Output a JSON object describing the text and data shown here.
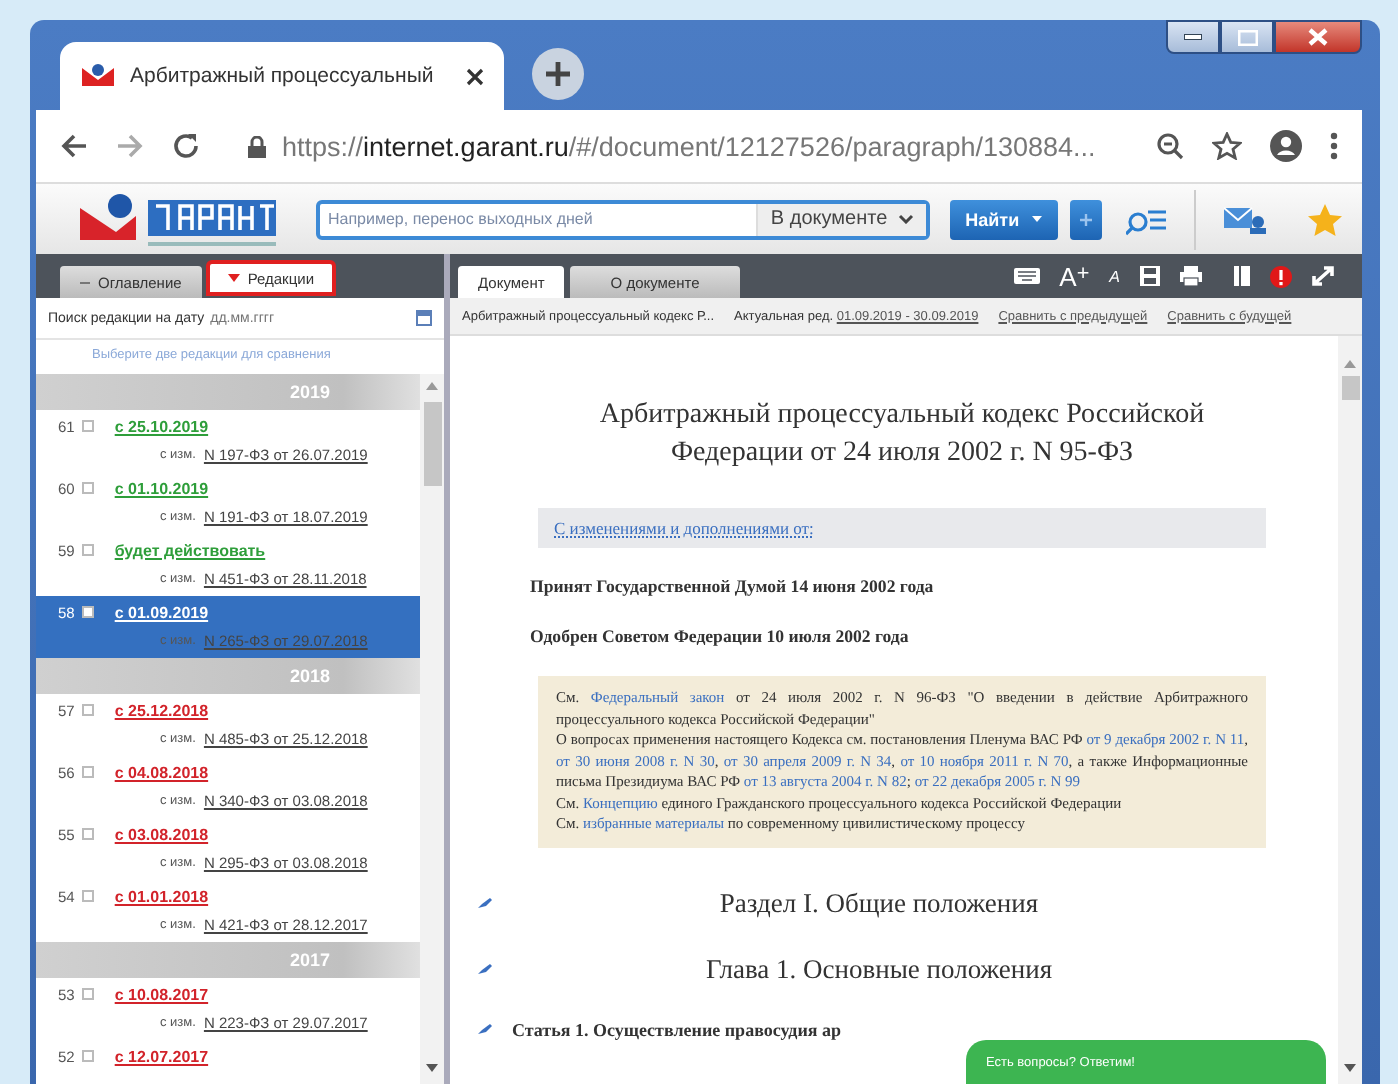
{
  "browser": {
    "tab_title": "Арбитражный процессуальный",
    "url": "https://**internet.garant.ru**/#/document/12127526/paragraph/130884..."
  },
  "toolbar": {
    "search_placeholder": "Например, перенос выходных дней",
    "scope": "В документе",
    "search_button": "Найти"
  },
  "left_tabs": [
    {
      "label": "Оглавление",
      "selected": false
    },
    {
      "label": "Редакции",
      "selected": true
    }
  ],
  "date_search": {
    "label": "Поиск редакции на дату",
    "placeholder": "дд.мм.гггг"
  },
  "hint": "Выберите две редакции для сравнения",
  "editions": [
    {
      "year": "2019",
      "items": [
        {
          "number": "61",
          "checked": false,
          "selected": false,
          "date": "с 25.10.2019",
          "color": "#2e9e3a",
          "change_label": "с изм.",
          "change": "N 197-ФЗ от 26.07.2019"
        },
        {
          "number": "60",
          "checked": false,
          "selected": false,
          "date": "с 01.10.2019",
          "color": "#2e9e3a",
          "change_label": "с изм.",
          "change": "N 191-ФЗ от 18.07.2019"
        },
        {
          "number": "59",
          "checked": false,
          "selected": false,
          "date": "будет действовать",
          "color": "#2e9e3a",
          "change_label": "с изм.",
          "change": "N 451-ФЗ от 28.11.2018"
        },
        {
          "number": "58",
          "checked": false,
          "selected": true,
          "date": "с 01.09.2019",
          "change_label": "с изм.",
          "change": "N 265-ФЗ от 29.07.2018"
        }
      ]
    },
    {
      "year": "2018",
      "items": [
        {
          "number": "57",
          "checked": false,
          "selected": false,
          "date": "с 25.12.2018",
          "color": "#d2232a",
          "change_label": "с изм.",
          "change": "N 485-ФЗ от 25.12.2018"
        },
        {
          "number": "56",
          "checked": false,
          "selected": false,
          "date": "с 04.08.2018",
          "color": "#d2232a",
          "change_label": "с изм.",
          "change": "N 340-ФЗ от 03.08.2018"
        },
        {
          "number": "55",
          "checked": false,
          "selected": false,
          "date": "с 03.08.2018",
          "color": "#d2232a",
          "change_label": "с изм.",
          "change": "N 295-ФЗ от 03.08.2018"
        },
        {
          "number": "54",
          "checked": false,
          "selected": false,
          "date": "с 01.01.2018",
          "color": "#d2232a",
          "change_label": "с изм.",
          "change": "N 421-ФЗ от 28.12.2017"
        }
      ]
    },
    {
      "year": "2017",
      "items": [
        {
          "number": "53",
          "checked": false,
          "selected": false,
          "date": "с 10.08.2017",
          "color": "#d2232a",
          "change_label": "с изм.",
          "change": "N 223-ФЗ от 29.07.2017"
        },
        {
          "number": "52",
          "checked": false,
          "selected": false,
          "date": "с 12.07.2017",
          "color": "#d2232a"
        }
      ]
    }
  ],
  "doc_tabs": [
    {
      "label": "Документ",
      "selected": true
    },
    {
      "label": "О документе",
      "selected": false
    }
  ],
  "doc_toolbar": {
    "font_increase": "A$^{+}$",
    "font_decrease": "A"
  },
  "info_bar": {
    "doc_name": "Арбитражный процессуальный кодекс Р...",
    "edition_label": "Актуальная ред.",
    "edition_dates": "01.09.2019 - 30.09.2019",
    "compare_prev": "Сравнить с предыдущей",
    "compare_next": "Сравнить с будущей"
  },
  "document": {
    "title": "Арбитражный процессуальный кодекс Российской Федерации от 24 июля 2002 г. N 95-ФЗ",
    "changes_link": "С изменениями и дополнениями от:",
    "adopted": "Принят Государственной Думой 14 июня 2002 года",
    "approved": "Одобрен Советом Федерации 10 июля 2002 года",
    "comment": [
      [
        {
          "text": "См. ",
          "link": false
        },
        {
          "text": "Федеральный закон",
          "link": true
        },
        {
          "text": " от 24 июля 2002 г. N 96-ФЗ \"О введении в действие Арбитражного процессуального кодекса Российской Федерации\"",
          "link": false
        }
      ],
      [
        {
          "text": "О вопросах применения настоящего Кодекса см. постановления Пленума ВАС РФ ",
          "link": false
        },
        {
          "text": "от 9 декабря 2002 г. N 11",
          "link": true
        },
        {
          "text": ", ",
          "link": false
        },
        {
          "text": "от 30 июня 2008 г. N 30",
          "link": true
        },
        {
          "text": ", ",
          "link": false
        },
        {
          "text": "от 30 апреля 2009 г. N 34",
          "link": true
        },
        {
          "text": ", ",
          "link": false
        },
        {
          "text": "от 10 ноября 2011 г. N 70",
          "link": true
        },
        {
          "text": ", а также Информационные письма Президиума ВАС РФ ",
          "link": false
        },
        {
          "text": "от 13 августа 2004 г. N 82",
          "link": true
        },
        {
          "text": "; ",
          "link": false
        },
        {
          "text": "от 22 декабря 2005 г. N 99",
          "link": true
        }
      ],
      [
        {
          "text": "См. ",
          "link": false
        },
        {
          "text": "Концепцию",
          "link": true
        },
        {
          "text": " единого Гражданского процессуального кодекса Российской Федерации",
          "link": false
        }
      ],
      [
        {
          "text": "См. ",
          "link": false
        },
        {
          "text": "избранные материалы",
          "link": true
        },
        {
          "text": " по современному цивилистическому процессу",
          "link": false
        }
      ]
    ],
    "headings": [
      {
        "kind": "section",
        "text": "Раздел I. Общие положения"
      },
      {
        "kind": "section",
        "text": "Глава 1. Основные положения"
      },
      {
        "kind": "article",
        "text": "Статья 1. Осуществление правосудия ар"
      }
    ]
  },
  "chat_button": "Есть вопросы? Ответим!"
}
